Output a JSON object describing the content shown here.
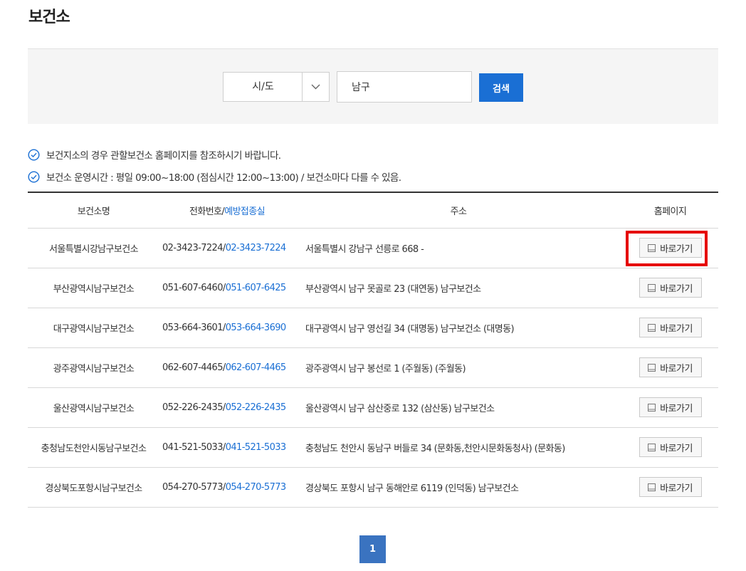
{
  "page_title": "보건소",
  "search": {
    "select_value": "시/도",
    "input_value": "남구",
    "button_label": "검색"
  },
  "notices": [
    "보건지소의 경우 관할보건소 홈페이지를 참조하시기 바랍니다.",
    "보건소 운영시간 : 평일 09:00~18:00 (점심시간 12:00~13:00) / 보건소마다 다를 수 있음."
  ],
  "table": {
    "headers": {
      "name": "보건소명",
      "tel_prefix": "전화번호/",
      "tel_vaccine": "예방접종실",
      "address": "주소",
      "homepage": "홈페이지"
    },
    "button_label": "바로가기",
    "rows": [
      {
        "name": "서울특별시강남구보건소",
        "tel": "02-3423-7224",
        "vaccine_tel": "02-3423-7224",
        "address": "서울특별시 강남구 선릉로 668 -"
      },
      {
        "name": "부산광역시남구보건소",
        "tel": "051-607-6460",
        "vaccine_tel": "051-607-6425",
        "address": "부산광역시 남구 못골로 23 (대연동) 남구보건소"
      },
      {
        "name": "대구광역시남구보건소",
        "tel": "053-664-3601",
        "vaccine_tel": "053-664-3690",
        "address": "대구광역시 남구 영선길 34 (대명동) 남구보건소 (대명동)"
      },
      {
        "name": "광주광역시남구보건소",
        "tel": "062-607-4465",
        "vaccine_tel": "062-607-4465",
        "address": "광주광역시 남구 봉선로 1 (주월동) (주월동)"
      },
      {
        "name": "울산광역시남구보건소",
        "tel": "052-226-2435",
        "vaccine_tel": "052-226-2435",
        "address": "울산광역시 남구 삼산중로 132 (삼산동) 남구보건소"
      },
      {
        "name": "충청남도천안시동남구보건소",
        "tel": "041-521-5033",
        "vaccine_tel": "041-521-5033",
        "address": "충청남도 천안시 동남구 버들로 34 (문화동,천안시문화동청사) (문화동)"
      },
      {
        "name": "경상북도포항시남구보건소",
        "tel": "054-270-5773",
        "vaccine_tel": "054-270-5773",
        "address": "경상북도 포항시 남구 동해안로 6119 (인덕동) 남구보건소"
      }
    ]
  },
  "pagination": {
    "current": "1"
  },
  "colors": {
    "accent": "#1a6fd4",
    "page_button": "#3a73c0",
    "highlight": "#e60000"
  },
  "icons": {
    "notice": "check-circle-icon",
    "select": "chevron-down-icon",
    "link": "window-icon"
  }
}
